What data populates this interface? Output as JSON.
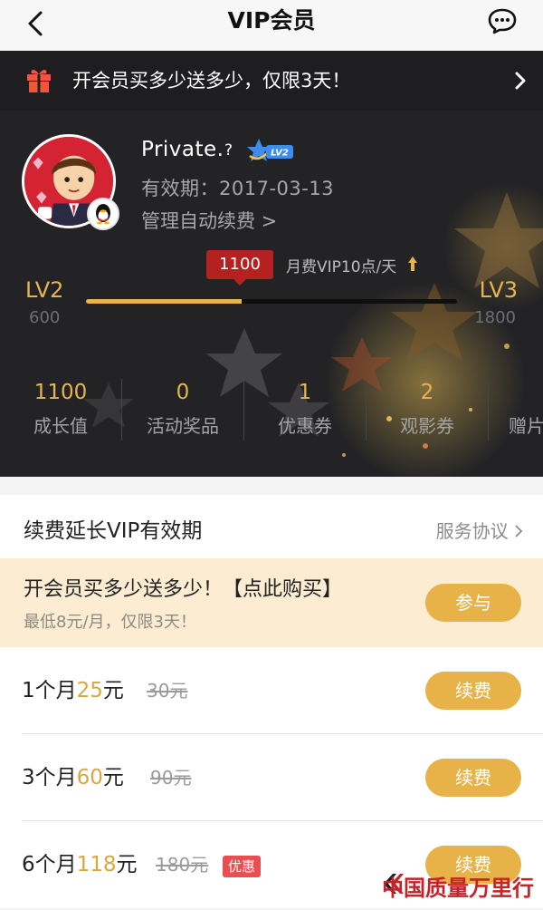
{
  "nav": {
    "title": "VIP会员"
  },
  "promo": {
    "text": "开会员买多少送多少，仅限3天！"
  },
  "profile": {
    "username": "Private.",
    "help": "?",
    "level_badge": "LV2",
    "expiry": "有效期：2017-03-13",
    "manage": "管理自动续费 >"
  },
  "growth": {
    "current": "1100",
    "progress_fraction": 0.42,
    "monthly_fee": "月费VIP10点/天",
    "left_level": "LV2",
    "left_value": "600",
    "right_level": "LV3",
    "right_value": "1800"
  },
  "stats": [
    {
      "value": "1100",
      "label": "成长值"
    },
    {
      "value": "0",
      "label": "活动奖品"
    },
    {
      "value": "1",
      "label": "优惠券"
    },
    {
      "value": "2",
      "label": "观影券"
    },
    {
      "value": "",
      "label": "赠片"
    }
  ],
  "renew": {
    "title": "续费延长VIP有效期",
    "service_link": "服务协议"
  },
  "offer": {
    "title": "开会员买多少送多少！【点此购买】",
    "subtitle": "最低8元/月，仅限3天！",
    "button": "参与"
  },
  "plans": [
    {
      "duration": "1个月",
      "price": "25",
      "unit": "元",
      "original": "30元",
      "tag": "",
      "button": "续费"
    },
    {
      "duration": "3个月",
      "price": "60",
      "unit": "元",
      "original": "90元",
      "tag": "",
      "button": "续费"
    },
    {
      "duration": "6个月",
      "price": "118",
      "unit": "元",
      "original": "180元",
      "tag": "优惠",
      "button": "续费"
    }
  ],
  "watermark": "中国质量万里行",
  "colors": {
    "gold": "#e7b349",
    "banner": "#1e1e20",
    "header": "#232325",
    "offer_bg": "#fcecd2",
    "tag_red": "#e94f4f"
  }
}
